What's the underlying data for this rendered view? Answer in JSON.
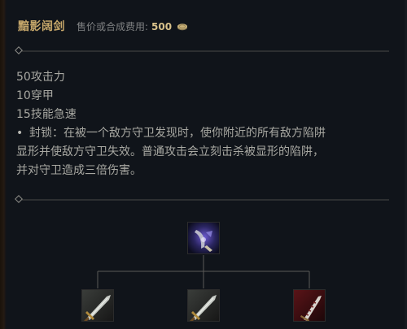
{
  "item": {
    "name": "黯影阔剑",
    "cost_label": "售价或合成费用:",
    "cost_value": "500",
    "icon": "gold-coin-icon"
  },
  "stats": [
    "50攻击力",
    "10穿甲",
    "15技能急速"
  ],
  "passive": {
    "bullet": "•",
    "line1": "封锁：在被一个敌方守卫发现时，使你附近的所有敌方陷阱",
    "line2": "显形并使敌方守卫失效。普通攻击会立刻击杀被显形的陷阱，",
    "line3": "并对守卫造成三倍伤害。"
  },
  "recipe": {
    "result_icon": "shadow-broadsword-icon",
    "components": [
      "long-sword-icon",
      "long-sword-icon",
      "serrated-dirk-icon"
    ]
  },
  "colors": {
    "title": "#c6a76a",
    "text": "#a8a8a2",
    "divider": "#4a4a48",
    "background": "#10141a"
  }
}
